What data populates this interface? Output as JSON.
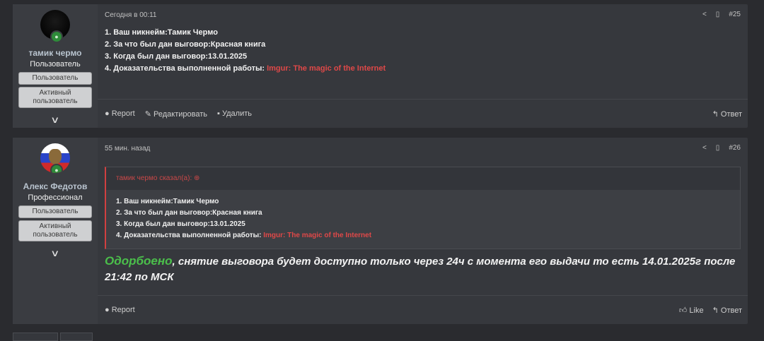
{
  "posts": [
    {
      "user": {
        "name": "тамик чермо",
        "title": "Пользователь",
        "badges": [
          "Пользователь",
          "Активный пользователь"
        ]
      },
      "time": "Сегодня в 00:11",
      "number": "#25",
      "lines": [
        "1. Ваш никнейм:Тамик Чермо",
        "2. За что был дан выговор:Красная книга",
        "3. Когда был дан выговор:13.01.2025"
      ],
      "proof_label": "4. Доказательства выполненной работы: ",
      "proof_link": "Imgur: The magic of the Internet",
      "footer": {
        "report": "Report",
        "edit": "Редактировать",
        "delete": "Удалить",
        "reply": "Ответ"
      }
    },
    {
      "user": {
        "name": "Алекс Федотов",
        "title": "Профессионал",
        "badges": [
          "Пользователь",
          "Активный пользователь"
        ]
      },
      "time": "55 мин. назад",
      "number": "#26",
      "quote": {
        "author": "тамик чермо сказал(а):",
        "lines": [
          "1. Ваш никнейм:Тамик Чермо",
          "2. За что был дан выговор:Красная книга",
          "3. Когда был дан выговор:13.01.2025"
        ],
        "proof_label": "4. Доказательства выполненной работы: ",
        "proof_link": "Imgur: The magic of the Internet"
      },
      "reply_green": "Одорбоено",
      "reply_text": ", снятие выговора будет доступно только через 24ч с момента его выдачи то есть 14.01.2025г после 21:42 по МСК",
      "footer": {
        "report": "Report",
        "like": "Like",
        "reply": "Ответ"
      }
    }
  ],
  "icons": {
    "share": "share-icon",
    "bookmark": "bookmark-icon",
    "report": "report-icon",
    "edit": "pencil-icon",
    "delete": "trash-icon",
    "reply": "reply-icon",
    "like": "thumbs-up-icon",
    "expand": "chevron-down-icon"
  },
  "colors": {
    "link": "#e04848",
    "approve": "#4bbf4b",
    "online": "#2e8b3a"
  }
}
